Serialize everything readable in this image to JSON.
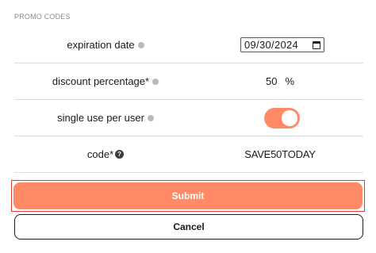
{
  "section": {
    "title": "PROMO CODES"
  },
  "fields": {
    "expiration": {
      "label": "expiration date",
      "value": "09/30/2024"
    },
    "discount": {
      "label": "discount percentage*",
      "value": "50",
      "unit": "%"
    },
    "single_use": {
      "label": "single use per user",
      "checked": true
    },
    "code": {
      "label": "code*",
      "value": "SAVE50TODAY",
      "help_glyph": "?"
    }
  },
  "buttons": {
    "submit": "Submit",
    "cancel": "Cancel"
  },
  "colors": {
    "accent": "#ff8a65",
    "focus_border": "#e53935"
  },
  "icons": {
    "info": "info-icon",
    "help": "help-icon",
    "calendar": "calendar-icon"
  }
}
